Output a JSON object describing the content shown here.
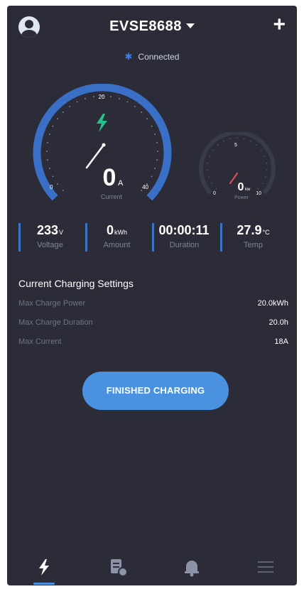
{
  "header": {
    "device_name": "EVSE8688",
    "status": "Connected"
  },
  "colors": {
    "background": "#2b2c38",
    "accent": "#4a92e0",
    "gauge_ring": "#3a6fc6",
    "lightning": "#25c48a",
    "needle_small": "#e0525b"
  },
  "gauge_current": {
    "value": "0",
    "unit": "A",
    "label": "Current",
    "min_label": "0",
    "mid_label": "20",
    "max_label": "40"
  },
  "gauge_power": {
    "value": "0",
    "unit": "kw",
    "label": "Power",
    "min_label": "0",
    "mid_label": "5",
    "max_label": "10"
  },
  "stats": [
    {
      "value": "233",
      "unit": "V",
      "label": "Voltage"
    },
    {
      "value": "0",
      "unit": "kWh",
      "label": "Amount"
    },
    {
      "value": "00:00:11",
      "unit": "",
      "label": "Duration"
    },
    {
      "value": "27.9",
      "unit": "°C",
      "label": "Temp"
    }
  ],
  "settings": {
    "title": "Current Charging Settings",
    "rows": [
      {
        "label": "Max Charge Power",
        "value": "20.0kWh"
      },
      {
        "label": "Max Charge Duration",
        "value": "20.0h"
      },
      {
        "label": "Max Current",
        "value": "18A"
      }
    ]
  },
  "action_button": "FINISHED CHARGING",
  "tabs": [
    {
      "icon": "lightning-icon",
      "active": true
    },
    {
      "icon": "document-icon",
      "active": false
    },
    {
      "icon": "bell-icon",
      "active": false
    },
    {
      "icon": "menu-icon",
      "active": false
    }
  ]
}
